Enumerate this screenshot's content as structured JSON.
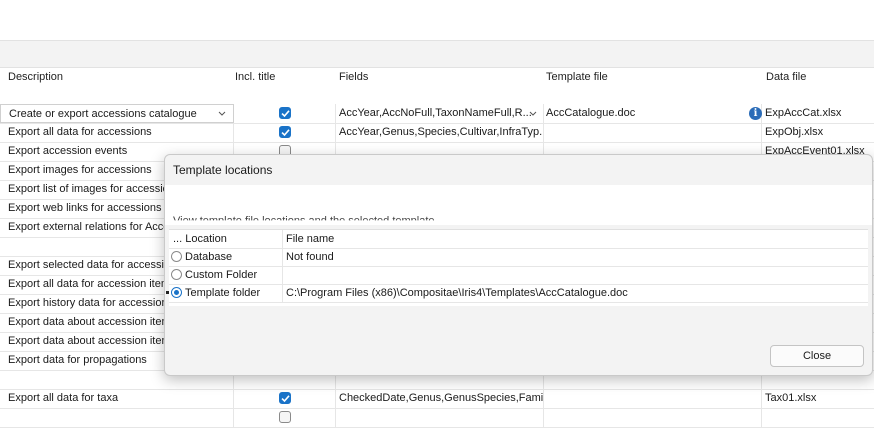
{
  "columns": {
    "description": "Description",
    "incl_title": "Incl. title",
    "fields": "Fields",
    "template_file": "Template file",
    "data_file": "Data file"
  },
  "rows": [
    {
      "description": "Create or export accessions catalogue",
      "incl_title": true,
      "fields": "AccYear,AccNoFull,TaxonNameFull,R...",
      "template_file": "AccCatalogue.doc",
      "data_file": "ExpAccCat.xlsx"
    },
    {
      "description": "Export all data for accessions",
      "incl_title": true,
      "fields": "AccYear,Genus,Species,Cultivar,InfraTyp...",
      "template_file": "",
      "data_file": "ExpObj.xlsx"
    },
    {
      "description": "Export accession events",
      "incl_title": false,
      "fields": "",
      "template_file": "",
      "data_file": "ExpAccEvent01.xlsx"
    },
    {
      "description": "Export images for accessions",
      "incl_title": null,
      "fields": "",
      "template_file": "",
      "data_file": ""
    },
    {
      "description": "Export list of images for accessions",
      "incl_title": null,
      "fields": "",
      "template_file": "",
      "data_file": ""
    },
    {
      "description": "Export web links for accessions",
      "incl_title": null,
      "fields": "",
      "template_file": "",
      "data_file": ""
    },
    {
      "description": "Export external relations for Accessions",
      "incl_title": null,
      "fields": "",
      "template_file": "",
      "data_file": ""
    },
    {
      "description": "",
      "incl_title": null,
      "fields": "",
      "template_file": "",
      "data_file": ""
    },
    {
      "description": "Export selected data for accessions",
      "incl_title": null,
      "fields": "",
      "template_file": "",
      "data_file": ""
    },
    {
      "description": "Export all data for accession items",
      "incl_title": null,
      "fields": "",
      "template_file": "",
      "data_file": ""
    },
    {
      "description": "Export history data for accession items",
      "incl_title": null,
      "fields": "",
      "template_file": "",
      "data_file": ""
    },
    {
      "description": "Export data about accession items",
      "incl_title": null,
      "fields": "",
      "template_file": "",
      "data_file": ""
    },
    {
      "description": "Export data about accession items",
      "incl_title": null,
      "fields": "",
      "template_file": "",
      "data_file": ""
    },
    {
      "description": "Export data for propagations",
      "incl_title": null,
      "fields": "",
      "template_file": "",
      "data_file": ""
    },
    {
      "description": "",
      "incl_title": null,
      "fields": "",
      "template_file": "",
      "data_file": ""
    },
    {
      "description": "Export all data for taxa",
      "incl_title": true,
      "fields": "CheckedDate,Genus,GenusSpecies,Famil...",
      "template_file": "",
      "data_file": "Tax01.xlsx"
    },
    {
      "description": "",
      "incl_title": false,
      "fields": "",
      "template_file": "",
      "data_file": ""
    }
  ],
  "dialog": {
    "title": "Template locations",
    "description": "View template file locations and the selected template",
    "col_location": "Location",
    "col_location_prefix": "...",
    "col_file_name": "File name",
    "locations": [
      {
        "label": "Database",
        "file": "Not found",
        "selected": false
      },
      {
        "label": "Custom Folder",
        "file": "",
        "selected": false
      },
      {
        "label": "Template folder",
        "file": "C:\\Program Files (x86)\\Compositae\\Iris4\\Templates\\AccCatalogue.doc",
        "selected": true
      }
    ],
    "close_label": "Close"
  },
  "colors": {
    "accent": "#1a73c8",
    "info": "#2b6cb8"
  },
  "icons": {
    "dropdown": "chevron-down-icon",
    "info": "info-icon",
    "checkbox": "checkmark-icon"
  }
}
